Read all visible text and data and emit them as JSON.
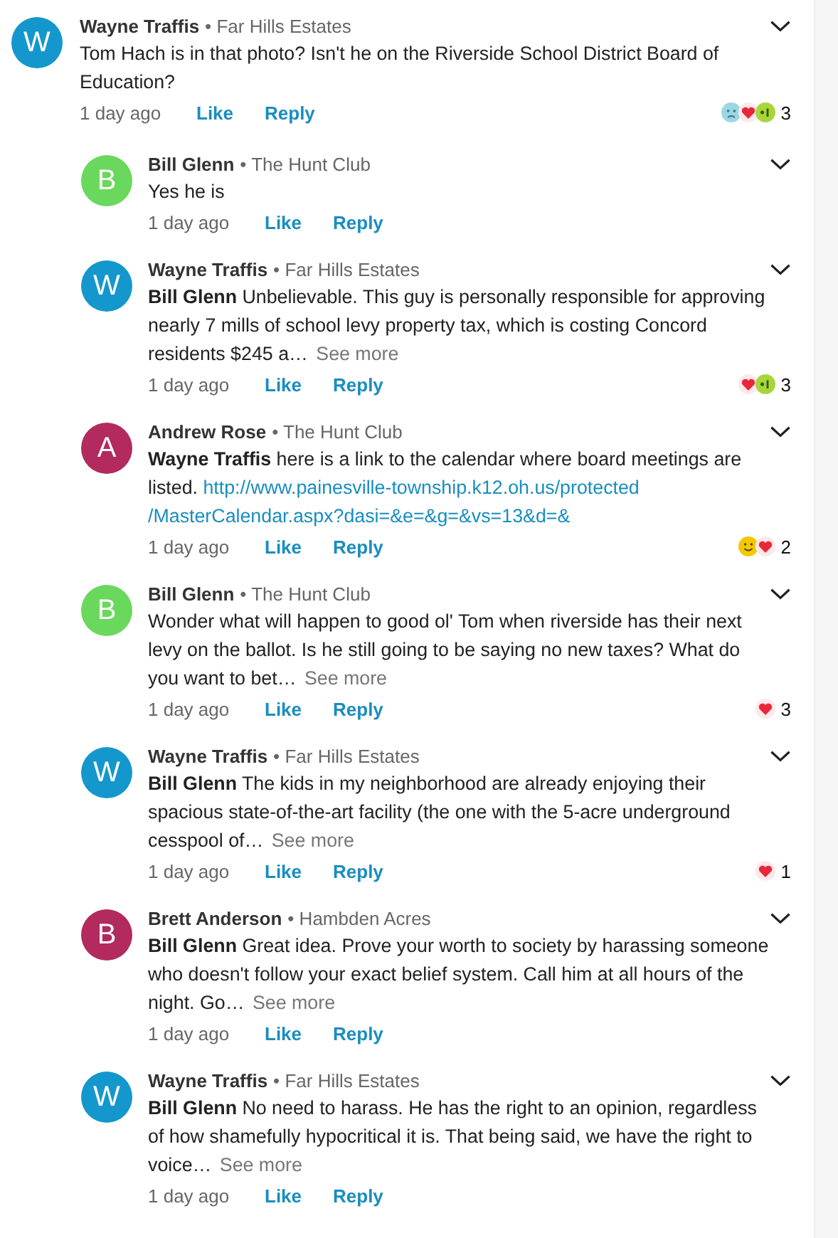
{
  "comments": [
    {
      "initial": "W",
      "color": "#1497cc",
      "author": "Wayne Traffis",
      "community": "• Far Hills Estates",
      "body": "Tom Hach is in that photo?  Isn't he on the Riverside School District Board of Education?",
      "time": "1 day ago",
      "actions": [
        "Like",
        "Reply"
      ],
      "reactions": [
        {
          "kind": "sad"
        },
        {
          "kind": "love"
        },
        {
          "kind": "plus"
        }
      ],
      "reaction_count": "3",
      "replies": [
        {
          "initial": "B",
          "color": "#6ad85c",
          "author": "Bill Glenn",
          "community": "• The Hunt Club",
          "body": "Yes he is",
          "time": "1 day ago",
          "actions": [
            "Like",
            "Reply"
          ]
        },
        {
          "initial": "W",
          "color": "#1497cc",
          "author": "Wayne Traffis",
          "community": "• Far Hills Estates",
          "body": "**Bill Glenn** Unbelievable. This guy is personally responsible for approving nearly 7 mills of school levy property tax, which is costing Concord residents $245 a…",
          "see_more": "See more",
          "time": "1 day ago",
          "actions": [
            "Like",
            "Reply"
          ],
          "reactions": [
            {
              "kind": "love"
            },
            {
              "kind": "plus"
            }
          ],
          "reaction_count": "3"
        },
        {
          "initial": "A",
          "color": "#b22a5e",
          "author": "Andrew Rose",
          "community": "• The Hunt Club",
          "body": "**Wayne Traffis** here is a link to the calendar where board meetings are listed.",
          "link": [
            "http://www.painesville-township.k12.oh.us/protected",
            "/MasterCalendar.aspx?dasi=&e=&g=&vs=13&d=&"
          ],
          "time": "1 day ago",
          "actions": [
            "Like",
            "Reply"
          ],
          "reactions": [
            {
              "kind": "smile"
            },
            {
              "kind": "love"
            }
          ],
          "reaction_count": "2"
        },
        {
          "initial": "B",
          "color": "#6ad85c",
          "author": "Bill Glenn",
          "community": "• The Hunt Club",
          "body": "Wonder what will happen to good ol' Tom when riverside has their next levy on the ballot. Is he still going to be saying no new taxes? What do you want to bet…",
          "see_more": "See more",
          "time": "1 day ago",
          "actions": [
            "Like",
            "Reply"
          ],
          "reactions": [
            {
              "kind": "love"
            }
          ],
          "reaction_count": "3"
        },
        {
          "initial": "W",
          "color": "#1497cc",
          "author": "Wayne Traffis",
          "community": "• Far Hills Estates",
          "body": "**Bill Glenn** The kids in my neighborhood are already enjoying their spacious state-of-the-art facility (the one with the 5-acre underground cesspool of…",
          "see_more": "See more",
          "time": "1 day ago",
          "actions": [
            "Like",
            "Reply"
          ],
          "reactions": [
            {
              "kind": "love"
            }
          ],
          "reaction_count": "1"
        },
        {
          "initial": "B",
          "color": "#b22a5e",
          "author": "Brett Anderson",
          "community": "• Hambden Acres",
          "body": "**Bill Glenn** Great idea. Prove your worth to society by harassing someone who doesn't follow your exact belief system. Call him at all hours of the night. Go…",
          "see_more": "See more",
          "time": "1 day ago",
          "actions": [
            "Like",
            "Reply"
          ]
        },
        {
          "initial": "W",
          "color": "#1497cc",
          "author": "Wayne Traffis",
          "community": "• Far Hills Estates",
          "body": "**Bill Glenn** No need to harass. He has the right to an opinion, regardless of how shamefully hypocritical it is. That being said, we have the right to voice…",
          "see_more": "See more",
          "time": "1 day ago",
          "actions": [
            "Like",
            "Reply"
          ]
        }
      ]
    }
  ]
}
